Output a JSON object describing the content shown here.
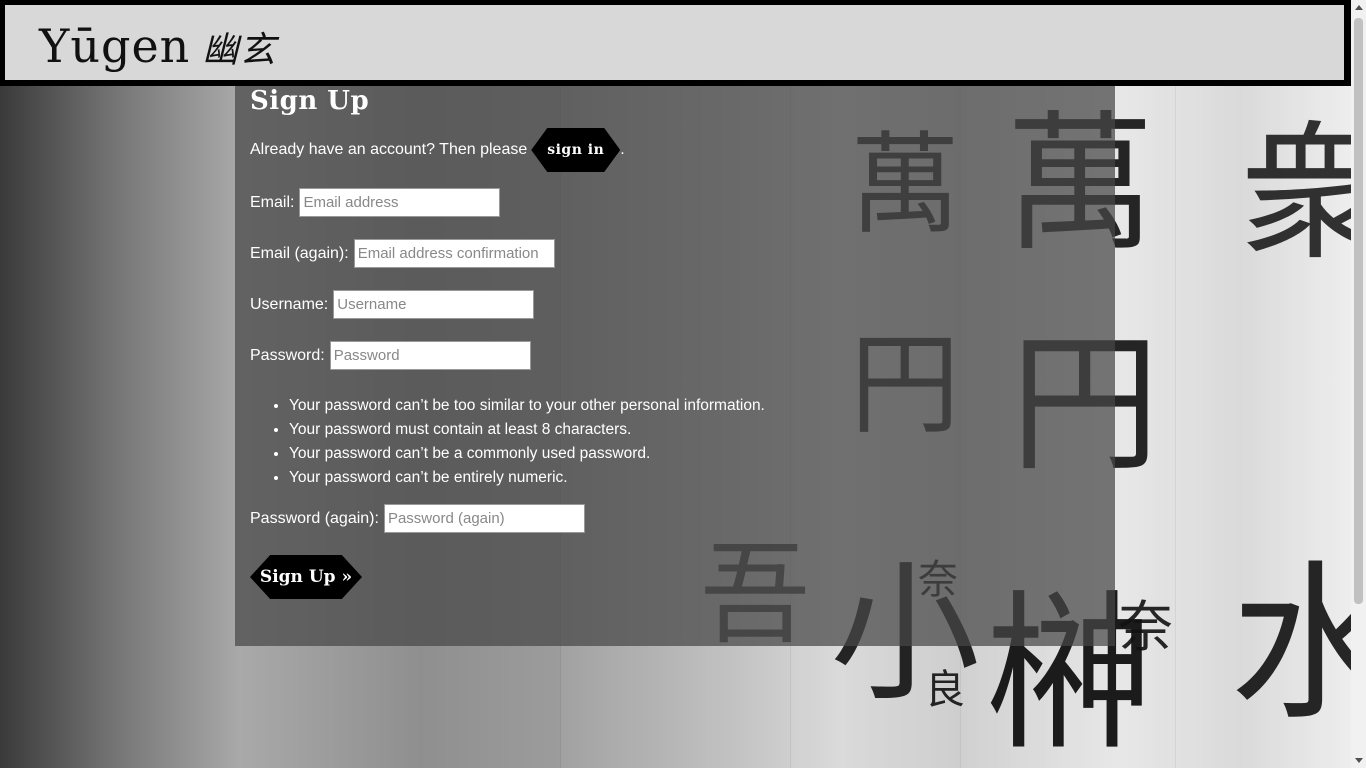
{
  "header": {
    "brand_main": "Yūgen",
    "brand_kanji": "幽玄"
  },
  "page": {
    "title": "Sign Up",
    "signin_prompt": "Already have an account? Then please",
    "signin_button": "sign in",
    "signin_suffix": "."
  },
  "form": {
    "email_label": "Email:",
    "email_placeholder": "Email address",
    "email2_label": "Email (again):",
    "email2_placeholder": "Email address confirmation",
    "username_label": "Username:",
    "username_placeholder": "Username",
    "password_label": "Password:",
    "password_placeholder": "Password",
    "password_rules": [
      "Your password can’t be too similar to your other personal information.",
      "Your password must contain at least 8 characters.",
      "Your password can’t be a commonly used password.",
      "Your password can’t be entirely numeric."
    ],
    "password2_label": "Password (again):",
    "password2_placeholder": "Password (again)",
    "submit_label": "Sign Up »"
  },
  "background": {
    "kanji": [
      "萬",
      "円",
      "萬",
      "円",
      "小",
      "良",
      "奈",
      "奈",
      "榊",
      "水",
      "吾",
      "衆"
    ]
  }
}
